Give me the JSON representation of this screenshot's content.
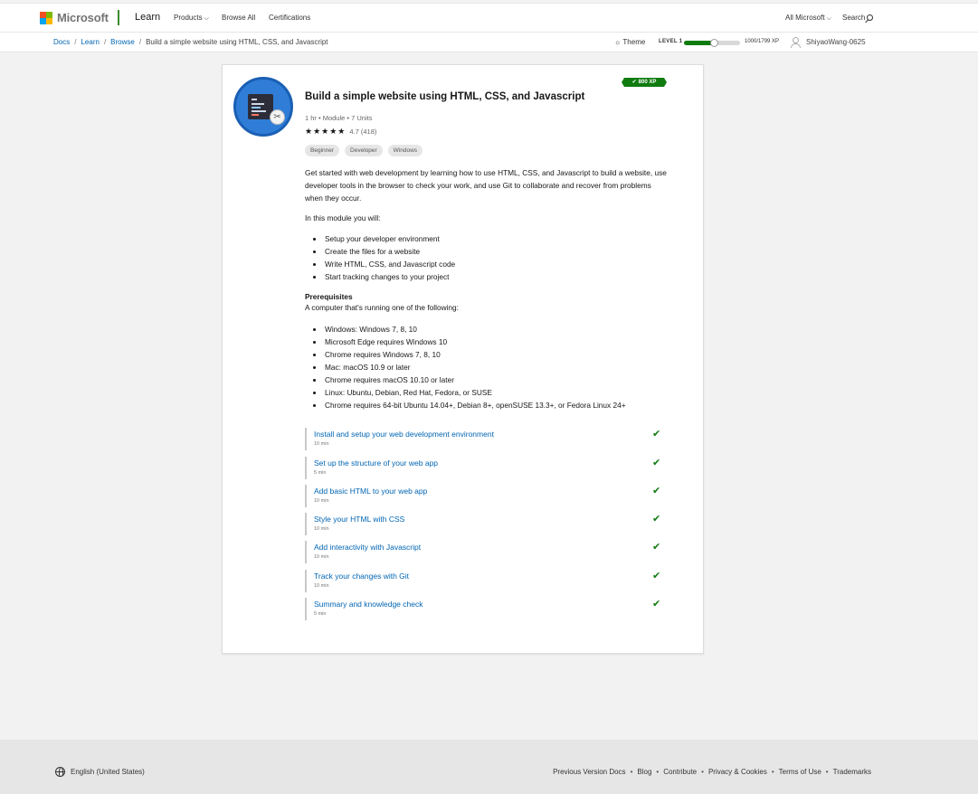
{
  "header": {
    "brand": "Microsoft",
    "product": "Learn",
    "nav": [
      "Products",
      "Browse All",
      "Certifications"
    ],
    "all_microsoft": "All Microsoft",
    "search": "Search"
  },
  "breadcrumb": {
    "items": [
      "Docs",
      "Learn",
      "Browse"
    ],
    "current": "Build a simple website using HTML, CSS, and Javascript"
  },
  "user_bar": {
    "theme": "Theme",
    "level": "LEVEL 1",
    "xp_text": "1000/1799 XP",
    "xp_progress": 0.556,
    "username": "ShiyaoWang-0625"
  },
  "module": {
    "xp_badge": "800 XP",
    "title": "Build a simple website using HTML, CSS, and Javascript",
    "meta": "1 hr • Module • 7 Units",
    "stars": "★★★★★",
    "rating": "4.7 (418)",
    "tags": [
      "Beginner",
      "Developer",
      "Windows"
    ],
    "description": "Get started with web development by learning how to use HTML, CSS, and Javascript to build a website, use developer tools in the browser to check your work, and use Git to collaborate and recover from problems when they occur.",
    "intro": "In this module you will:",
    "objectives": [
      "Setup your developer environment",
      "Create the files for a website",
      "Write HTML, CSS, and Javascript code",
      "Start tracking changes to your project"
    ],
    "prereq_heading": "Prerequisites",
    "prereq_text": "A computer that's running one of the following:",
    "prereqs": [
      "Windows: Windows 7, 8, 10",
      "Microsoft Edge requires Windows 10",
      "Chrome requires Windows 7, 8, 10",
      "Mac: macOS 10.9 or later",
      "Chrome requires macOS 10.10 or later",
      "Linux: Ubuntu, Debian, Red Hat, Fedora, or SUSE",
      "Chrome requires 64-bit Ubuntu 14.04+, Debian 8+, openSUSE 13.3+, or Fedora Linux 24+"
    ],
    "units": [
      {
        "title": "Install and setup your web development environment",
        "time": "10 min",
        "completed": true
      },
      {
        "title": "Set up the structure of your web app",
        "time": "5 min",
        "completed": true
      },
      {
        "title": "Add basic HTML to your web app",
        "time": "10 min",
        "completed": true
      },
      {
        "title": "Style your HTML with CSS",
        "time": "10 min",
        "completed": true
      },
      {
        "title": "Add interactivity with Javascript",
        "time": "10 min",
        "completed": true
      },
      {
        "title": "Track your changes with Git",
        "time": "10 min",
        "completed": true
      },
      {
        "title": "Summary and knowledge check",
        "time": "5 min",
        "completed": true
      }
    ]
  },
  "footer": {
    "locale": "English (United States)",
    "links": [
      "Previous Version Docs",
      "Blog",
      "Contribute",
      "Privacy & Cookies",
      "Terms of Use",
      "Trademarks"
    ]
  },
  "colors": {
    "accent_link": "#0065b3",
    "success_green": "#107c10"
  }
}
